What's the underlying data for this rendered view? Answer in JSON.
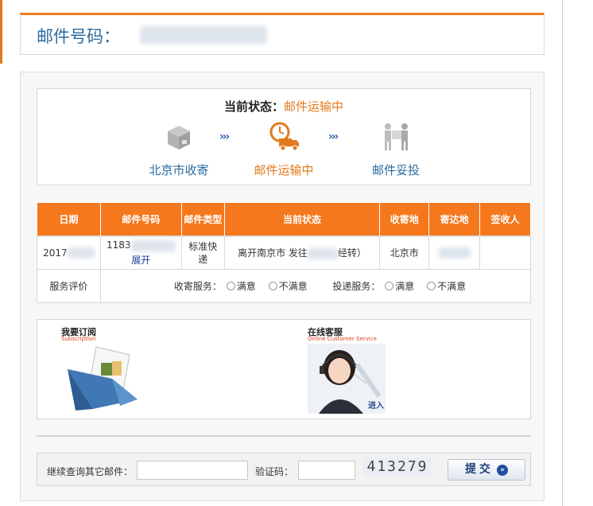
{
  "header": {
    "title": "邮件号码："
  },
  "status": {
    "label": "当前状态：",
    "value": "邮件运输中",
    "steps": [
      {
        "label": "北京市收寄",
        "icon": "package-box-icon"
      },
      {
        "label": "邮件运输中",
        "icon": "delivery-truck-clock-icon"
      },
      {
        "label": "邮件妥投",
        "icon": "delivered-person-icon"
      }
    ],
    "arrow": "›››",
    "accent": "#e07a1b",
    "link_color": "#2a6a9e"
  },
  "table": {
    "headers": [
      "日期",
      "邮件号码",
      "邮件类型",
      "当前状态",
      "收寄地",
      "寄达地",
      "签收人"
    ],
    "row": {
      "date": "2017",
      "number": "1183",
      "expand": "展开",
      "type": "标准快递",
      "state_prefix": "离开南京市 发往",
      "state_suffix": "经转）",
      "origin": "北京市",
      "destination": "",
      "signer": ""
    },
    "header_color": "#f5781c"
  },
  "evaluation": {
    "label": "服务评价",
    "collect_label": "收寄服务：",
    "deliver_label": "投递服务：",
    "satisfied": "满意",
    "unsatisfied": "不满意"
  },
  "ads": {
    "subscribe_title": "我要订阅",
    "subscribe_sub": "Subscription",
    "service_title": "在线客服",
    "service_sub": "Online Customer Service",
    "service_enter": "进入"
  },
  "query": {
    "other_label": "继续查询其它邮件：",
    "captcha_label": "验证码：",
    "captcha_value": "413279",
    "submit": "提交"
  }
}
